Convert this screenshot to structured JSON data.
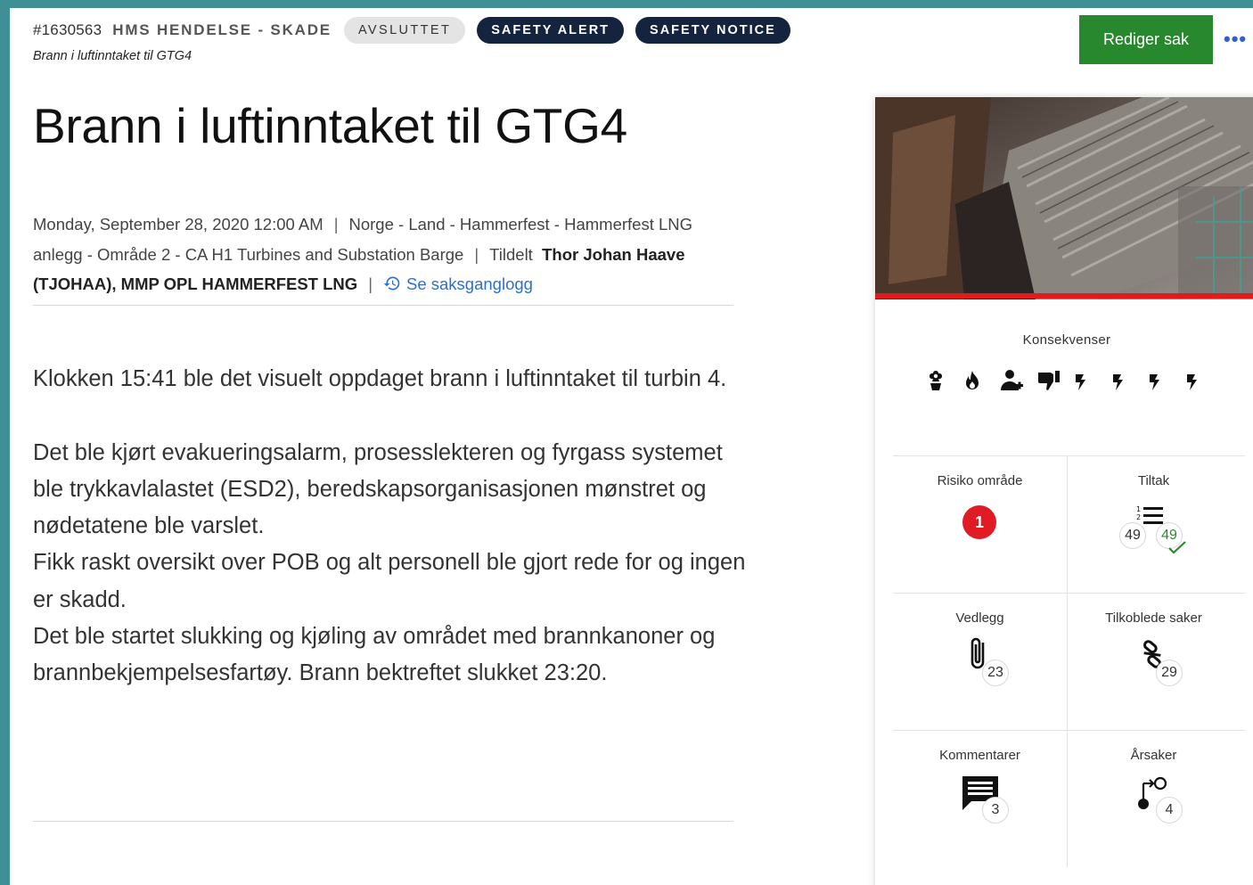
{
  "header": {
    "case_id": "#1630563",
    "case_type": "HMS HENDELSE - SKADE",
    "status": "AVSLUTTET",
    "tags": [
      "SAFETY ALERT",
      "SAFETY NOTICE"
    ],
    "breadcrumb": "Brann i luftinntaket til GTG4",
    "edit_label": "Rediger sak",
    "more_label": "•••"
  },
  "title": "Brann i luftinntaket til GTG4",
  "meta": {
    "date": "Monday, September 28, 2020 12:00 AM",
    "location": "Norge - Land - Hammerfest - Hammerfest LNG anlegg - Område 2 - CA H1 Turbines and Substation Barge",
    "assigned_label": "Tildelt",
    "assigned_to": "Thor Johan Haave (TJOHAA), MMP OPL HAMMERFEST LNG",
    "history_link": "Se saksganglogg"
  },
  "description": {
    "paragraphs": [
      "Klokken 15:41 ble det visuelt oppdaget brann i luftinntaket til turbin 4.",
      "Det ble kjørt evakueringsalarm, prosesslekteren og fyrgass systemet ble trykkavlalastet (ESD2),  beredskapsorganisasjonen mønstret og nødetatene ble varslet.",
      "Fikk raskt oversikt over POB og alt personell ble gjort rede for og ingen er skadd.",
      "Det ble startet slukking og kjøling av området med brannkanoner og brannbekjempelsesfartøy. Brann bektreftet slukket 23:20."
    ]
  },
  "panel": {
    "consequences_label": "Konsekvenser",
    "consequence_icons": [
      "environment-icon",
      "fire-icon",
      "person-injury-icon",
      "reputation-icon",
      "lightning-icon",
      "lightning-icon",
      "lightning-icon",
      "lightning-icon"
    ],
    "risk": {
      "label": "Risiko område",
      "value": "1",
      "color": "#e01b24"
    },
    "actions": {
      "label": "Tiltak",
      "total": "49",
      "completed": "49"
    },
    "attachments": {
      "label": "Vedlegg",
      "count": "23"
    },
    "linked": {
      "label": "Tilkoblede saker",
      "count": "29"
    },
    "comments": {
      "label": "Kommentarer",
      "count": "3"
    },
    "causes": {
      "label": "Årsaker",
      "count": "4"
    }
  },
  "colors": {
    "frame_border": "#3e8f96",
    "edit_button": "#27882e",
    "navy_tag": "#14233e",
    "link": "#2d6fd0",
    "risk_red": "#e01b24"
  }
}
